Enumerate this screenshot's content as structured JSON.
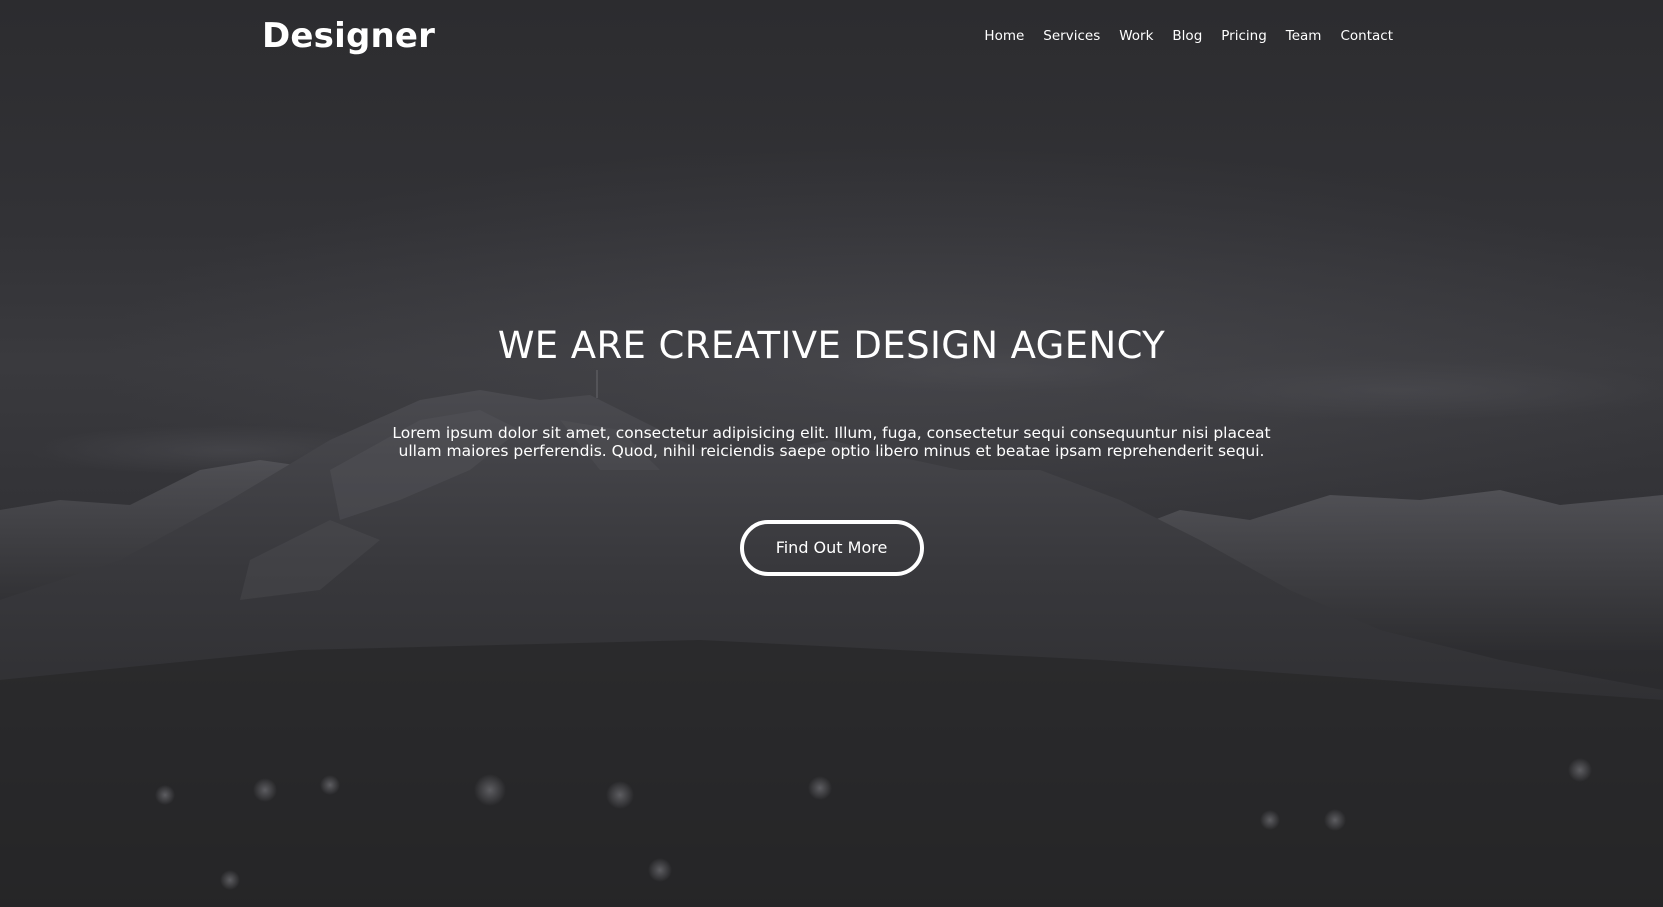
{
  "brand": {
    "logo_text": "Designer"
  },
  "nav": {
    "items": [
      {
        "label": "Home"
      },
      {
        "label": "Services"
      },
      {
        "label": "Work"
      },
      {
        "label": "Blog"
      },
      {
        "label": "Pricing"
      },
      {
        "label": "Team"
      },
      {
        "label": "Contact"
      }
    ]
  },
  "hero": {
    "title": "WE ARE CREATIVE DESIGN AGENCY",
    "text": "Lorem ipsum dolor sit amet, consectetur adipisicing elit. Illum, fuga, consectetur sequi consequuntur nisi placeat ullam maiores perferendis. Quod, nihil reiciendis saepe optio libero minus et beatae ipsam reprehenderit sequi.",
    "cta_label": "Find Out More"
  },
  "colors": {
    "text": "#ffffff",
    "background": "#2c2c2f"
  }
}
